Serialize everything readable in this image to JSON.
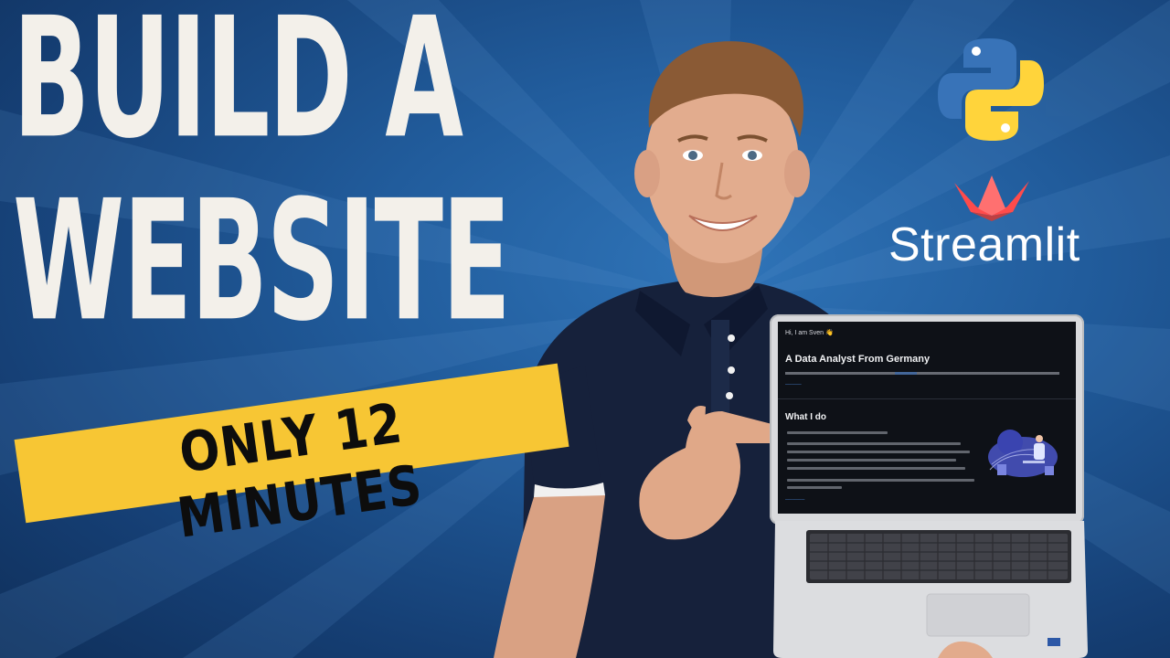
{
  "headline": {
    "line1": "BUILD A",
    "line2": "WEBSITE"
  },
  "badge": {
    "text": "ONLY 12 MINUTES",
    "color": "#f7c634"
  },
  "logos": {
    "python": "python-logo-icon",
    "streamlit_icon": "streamlit-crown-icon",
    "streamlit_label": "Streamlit"
  },
  "laptop_screen": {
    "greeting": "Hi, I am Sven 👋",
    "title": "A Data Analyst From Germany",
    "section_title": "What I do"
  },
  "colors": {
    "background": "#215c9c",
    "headline": "#f3f0ea",
    "badge_text": "#0d0d0d",
    "screen_bg": "#0e1117",
    "link": "#4f8ee6",
    "python_blue": "#3873b8",
    "python_yellow": "#ffd43b",
    "streamlit_red": "#ff4b4b"
  }
}
